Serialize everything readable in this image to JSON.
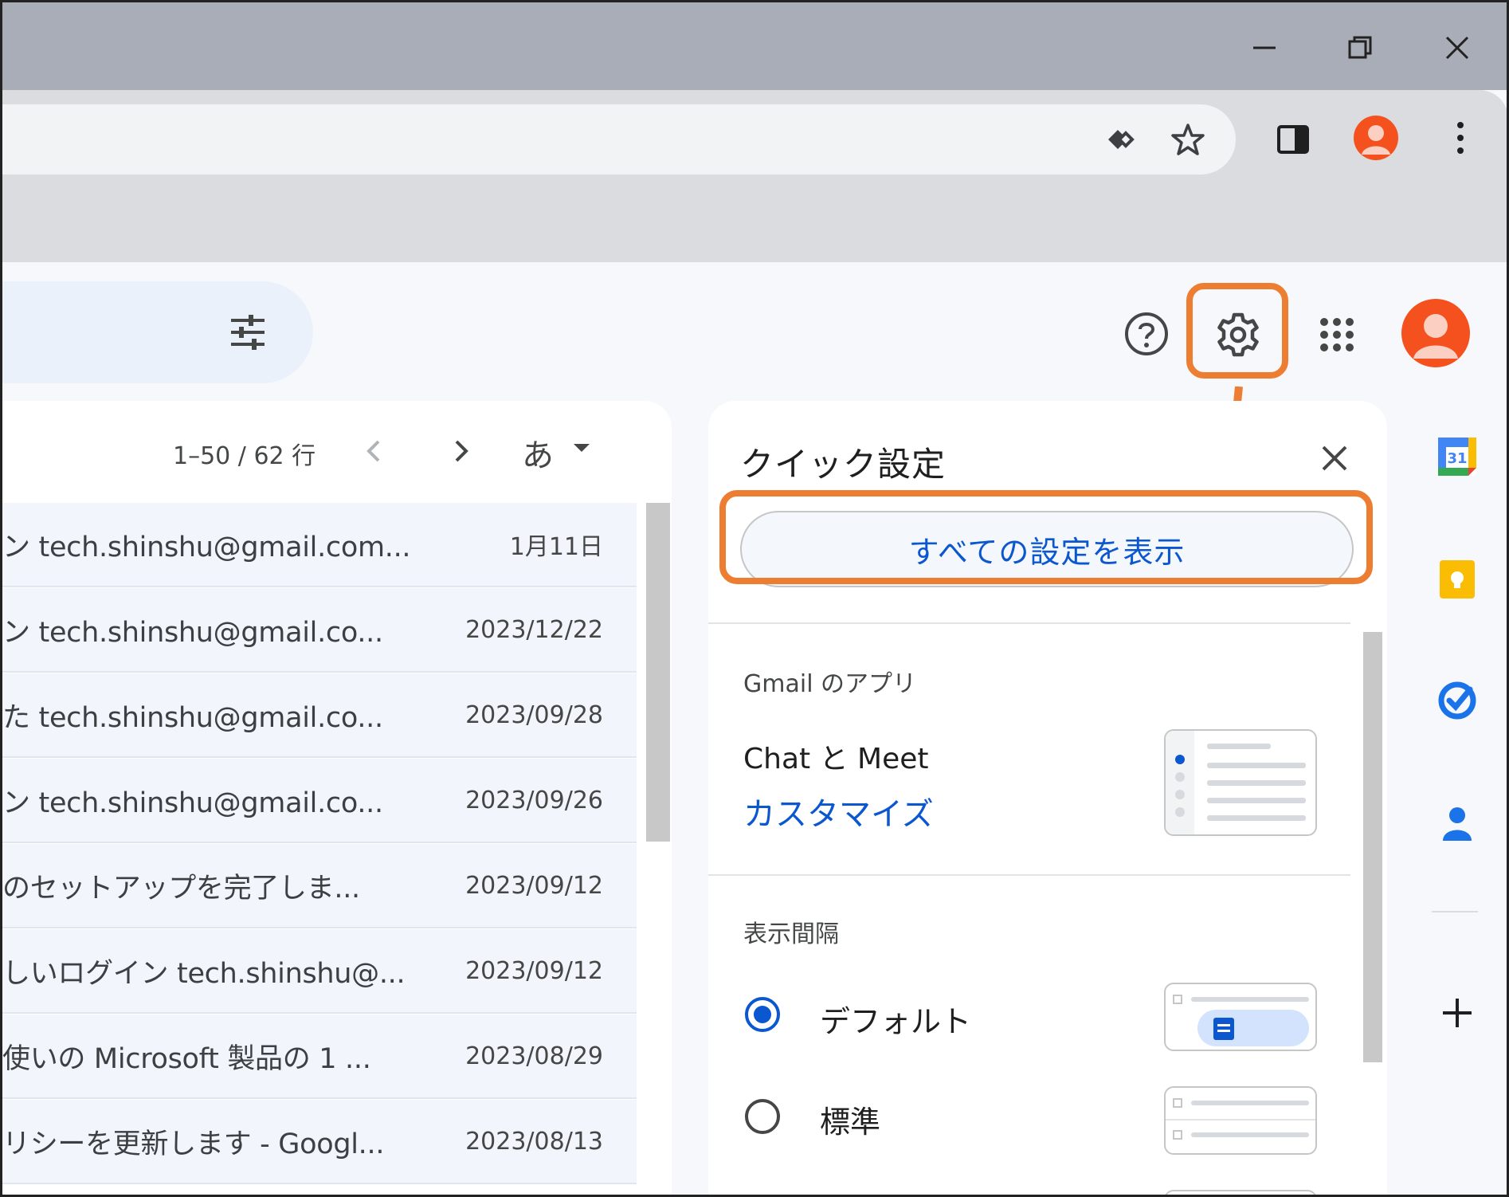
{
  "window": {
    "controls": [
      "minimize-icon",
      "restore-icon",
      "close-icon"
    ]
  },
  "toolbar": {
    "icons": [
      "password-manager-icon",
      "bookmark-star-icon",
      "side-panel-icon",
      "profile-avatar",
      "menu-icon"
    ]
  },
  "header": {
    "icons": [
      "search-options-icon",
      "help-icon",
      "settings-gear-icon",
      "apps-grid-icon",
      "account-avatar"
    ]
  },
  "maillist": {
    "range": "1–50 / 62 行",
    "input_tool": "あ",
    "rows": [
      {
        "subject": "ン tech.shinshu@gmail.com...",
        "date": "1月11日"
      },
      {
        "subject": "ン tech.shinshu@gmail.co...",
        "date": "2023/12/22"
      },
      {
        "subject": "た tech.shinshu@gmail.co...",
        "date": "2023/09/28"
      },
      {
        "subject": "ン tech.shinshu@gmail.co...",
        "date": "2023/09/26"
      },
      {
        "subject": "のセットアップを完了しま...",
        "date": "2023/09/12"
      },
      {
        "subject": "しいログイン tech.shinshu@...",
        "date": "2023/09/12"
      },
      {
        "subject": "使いの Microsoft 製品の 1 ...",
        "date": "2023/08/29"
      },
      {
        "subject": "リシーを更新します - Googl...",
        "date": "2023/08/13"
      }
    ]
  },
  "quick_settings": {
    "title": "クイック設定",
    "all_settings_button": "すべての設定を表示",
    "apps_section_label": "Gmail のアプリ",
    "chat_meet_label": "Chat と Meet",
    "customize_link": "カスタマイズ",
    "density_section_label": "表示間隔",
    "density_options": [
      {
        "label": "デフォルト",
        "selected": true
      },
      {
        "label": "標準",
        "selected": false
      }
    ]
  },
  "side_panel": {
    "icons": [
      "calendar-icon",
      "keep-icon",
      "tasks-icon",
      "contacts-icon",
      "add-addon-icon"
    ],
    "calendar_day": "31"
  },
  "colors": {
    "highlight": "#ed7d31",
    "accent_blue": "#0b57d0",
    "avatar_orange": "#f4511e"
  }
}
